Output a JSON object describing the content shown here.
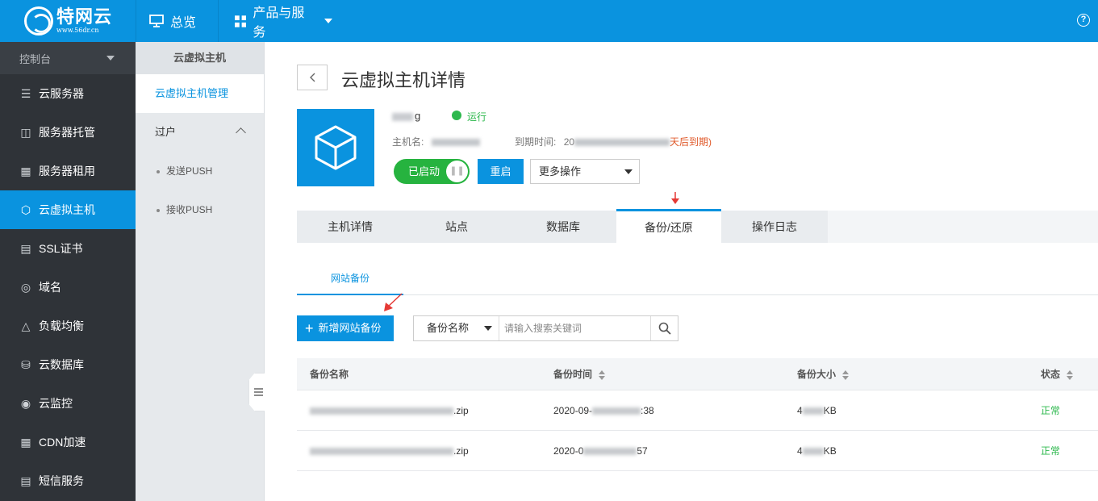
{
  "brand": {
    "name": "特网云",
    "domain": "www.56dr.cn"
  },
  "topnav": {
    "overview": "总览",
    "products": "产品与服务"
  },
  "help": "?",
  "sidebar": {
    "console": "控制台",
    "items": [
      {
        "label": "云服务器",
        "icon": "server-icon"
      },
      {
        "label": "服务器托管",
        "icon": "hosting-icon"
      },
      {
        "label": "服务器租用",
        "icon": "rental-icon"
      },
      {
        "label": "云虚拟主机",
        "icon": "cube-icon"
      },
      {
        "label": "SSL证书",
        "icon": "certificate-icon"
      },
      {
        "label": "域名",
        "icon": "globe-icon"
      },
      {
        "label": "负载均衡",
        "icon": "balance-icon"
      },
      {
        "label": "云数据库",
        "icon": "database-icon"
      },
      {
        "label": "云监控",
        "icon": "monitor-icon"
      },
      {
        "label": "CDN加速",
        "icon": "cdn-icon"
      },
      {
        "label": "短信服务",
        "icon": "sms-icon"
      }
    ],
    "active_index": 3
  },
  "subsidebar": {
    "header": "云虚拟主机",
    "manage": "云虚拟主机管理",
    "group": "过户",
    "subitems": [
      "发送PUSH",
      "接收PUSH"
    ]
  },
  "page": {
    "title": "云虚拟主机详情",
    "host_suffix": "g",
    "status": "运行",
    "hostname_label": "主机名:",
    "expire_label": "到期时间:",
    "expire_prefix": "20",
    "expire_suffix": "天后到期)",
    "toggle_label": "已启动",
    "restart": "重启",
    "more_ops": "更多操作"
  },
  "tabs": [
    "主机详情",
    "站点",
    "数据库",
    "备份/还原",
    "操作日志"
  ],
  "active_tab": 3,
  "subtab": "网站备份",
  "toolbar": {
    "add_backup": "新增网站备份",
    "search_field": "备份名称",
    "search_placeholder": "请输入搜索关键词"
  },
  "table": {
    "headers": [
      "备份名称",
      "备份时间",
      "备份大小",
      "状态"
    ],
    "rows": [
      {
        "name_suffix": ".zip",
        "time_prefix": "2020-09-",
        "time_suffix": ":38",
        "size_prefix": "4",
        "size_suffix": "KB",
        "status": "正常"
      },
      {
        "name_suffix": ".zip",
        "time_prefix": "2020-0",
        "time_suffix": "57",
        "size_prefix": "4",
        "size_suffix": "KB",
        "status": "正常"
      }
    ]
  },
  "colors": {
    "primary": "#0a93df",
    "success": "#2db84d",
    "sidebar_bg": "#2f3338",
    "warn": "#e05a2b"
  }
}
